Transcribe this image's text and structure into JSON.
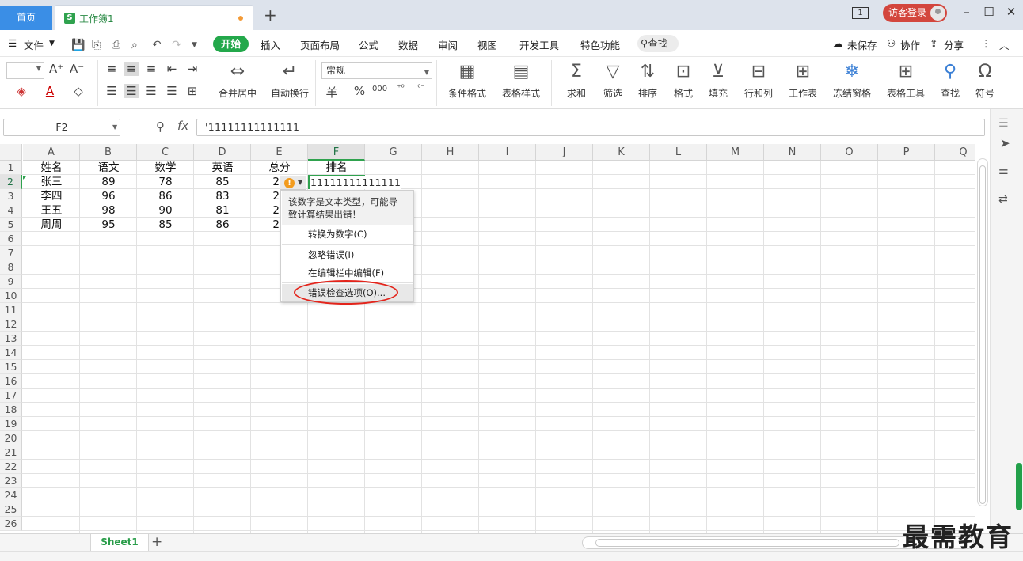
{
  "titlebar": {
    "home_tab": "首页",
    "doc_tab_icon": "S",
    "doc_tab": "工作簿1",
    "new_tab": "+",
    "window_badge": "1",
    "login": "访客登录"
  },
  "menubar": {
    "file": "文件",
    "tabs": [
      "开始",
      "插入",
      "页面布局",
      "公式",
      "数据",
      "审阅",
      "视图",
      "开发工具",
      "特色功能"
    ],
    "search": "查找",
    "unsaved": "未保存",
    "collab": "协作",
    "share": "分享"
  },
  "ribbon": {
    "merge": "合并居中",
    "wrap": "自动换行",
    "number_format": "常规",
    "currency": "羊",
    "percent": "%",
    "thousands": "000",
    "cond_format": "条件格式",
    "table_style": "表格样式",
    "sum": "求和",
    "filter": "筛选",
    "sort": "排序",
    "format": "格式",
    "fill": "填充",
    "rowcol": "行和列",
    "sheet": "工作表",
    "freeze": "冻结窗格",
    "tools": "表格工具",
    "find": "查找",
    "symbol": "符号"
  },
  "formula_bar": {
    "name_box": "F2",
    "fx": "fx",
    "formula": "'11111111111111"
  },
  "grid": {
    "columns": [
      "A",
      "B",
      "C",
      "D",
      "E",
      "F",
      "G",
      "H",
      "I",
      "J",
      "K",
      "L",
      "M",
      "N",
      "O",
      "P",
      "Q"
    ],
    "rows": [
      "1",
      "2",
      "3",
      "4",
      "5",
      "6",
      "7",
      "8",
      "9",
      "10",
      "11",
      "12",
      "13",
      "14",
      "15",
      "16",
      "17",
      "18",
      "19",
      "20",
      "21",
      "22",
      "23",
      "24",
      "25",
      "26"
    ],
    "headers": [
      "姓名",
      "语文",
      "数学",
      "英语",
      "总分",
      "排名"
    ],
    "data": [
      [
        "张三",
        "89",
        "78",
        "85",
        "25"
      ],
      [
        "李四",
        "96",
        "86",
        "83",
        "26"
      ],
      [
        "王五",
        "98",
        "90",
        "81",
        "26"
      ],
      [
        "周周",
        "95",
        "85",
        "86",
        "26"
      ]
    ],
    "f2_display": "11111111111111"
  },
  "error_popup": {
    "message": "该数字是文本类型，可能导致计算结果出错！",
    "items": [
      "转换为数字(C)",
      "忽略错误(I)",
      "在编辑栏中编辑(F)",
      "错误检查选项(O)..."
    ]
  },
  "sheets": {
    "active": "Sheet1",
    "add": "+"
  },
  "watermark": "最需教育",
  "colors": {
    "accent": "#23a84b",
    "tab_blue": "#3a8ee6",
    "login_red": "#d3463d",
    "circle_red": "#e3241b",
    "warning_orange": "#f29b1d"
  }
}
